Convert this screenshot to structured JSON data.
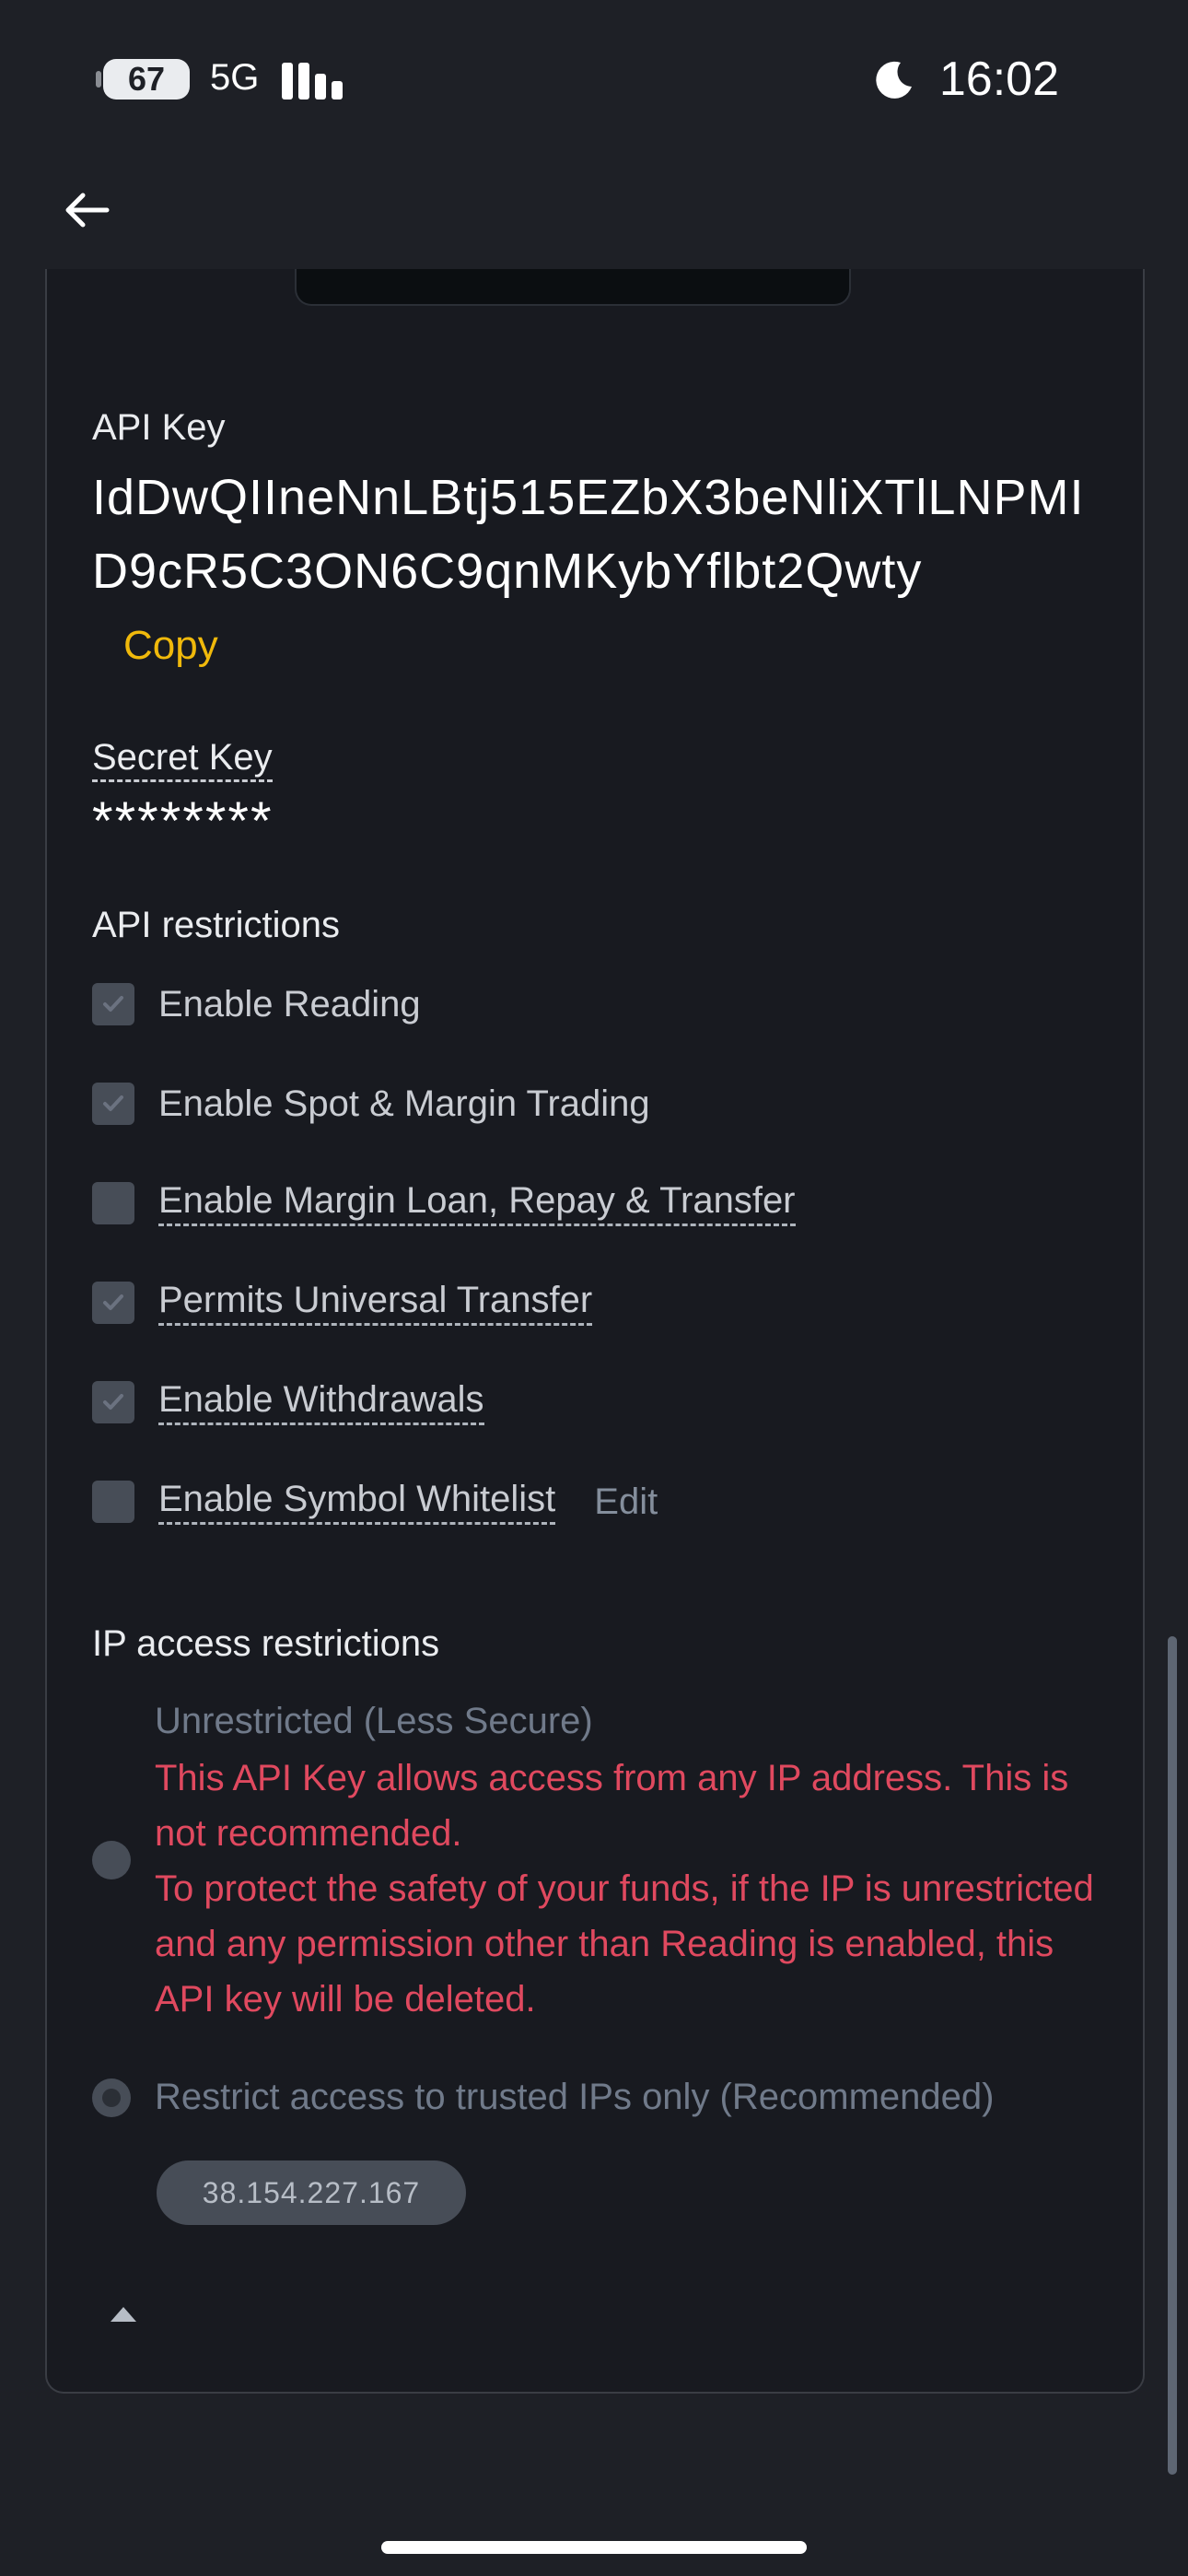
{
  "status_bar": {
    "battery": "67",
    "network": "5G",
    "time": "16:02"
  },
  "api_key": {
    "label": "API Key",
    "value": "IdDwQIIneNnLBtj515EZbX3beNliXTlLNPMID9cR5C3ON6C9qnMKybYflbt2Qwty",
    "copy_label": "Copy"
  },
  "secret_key": {
    "label": "Secret Key",
    "value": "********"
  },
  "restrictions": {
    "title": "API restrictions",
    "items": [
      {
        "label": "Enable Reading",
        "checked": true
      },
      {
        "label": "Enable Spot & Margin Trading",
        "checked": true
      },
      {
        "label": "Enable Margin Loan, Repay & Transfer",
        "checked": false
      },
      {
        "label": "Permits Universal Transfer",
        "checked": true
      },
      {
        "label": "Enable Withdrawals",
        "checked": true
      },
      {
        "label": "Enable Symbol Whitelist",
        "checked": false
      }
    ],
    "edit_label": "Edit"
  },
  "ip_access": {
    "title": "IP access restrictions",
    "unrestricted_label": "Unrestricted (Less Secure)",
    "warning_1": "This API Key allows access from any IP address. This is not recommended.",
    "warning_2": "To protect the safety of your funds, if the IP is unrestricted and any permission other than Reading is enabled, this API key will be deleted.",
    "restricted_label": "Restrict access to trusted IPs only (Recommended)",
    "ip": "38.154.227.167",
    "selected": "restricted"
  },
  "colors": {
    "background": "#1e2026",
    "accent": "#f0b90b",
    "warning": "#e0495f"
  }
}
